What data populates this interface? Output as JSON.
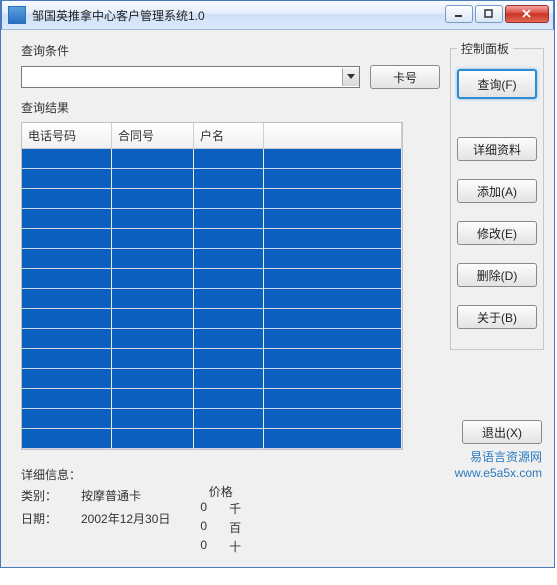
{
  "window": {
    "title": "邹国英推拿中心客户管理系统1.0"
  },
  "search": {
    "section_label": "查询条件",
    "combo_value": "",
    "card_btn": "卡号"
  },
  "results": {
    "section_label": "查询结果",
    "columns": [
      "电话号码",
      "合同号",
      "户名"
    ],
    "row_count": 15
  },
  "control_panel": {
    "title": "控制面板",
    "query_btn": "查询(F)",
    "detail_btn": "详细资料",
    "add_btn": "添加(A)",
    "edit_btn": "修改(E)",
    "delete_btn": "删除(D)",
    "about_btn": "关于(B)",
    "exit_btn": "退出(X)"
  },
  "details": {
    "heading": "详细信息：",
    "type_label": "类别：",
    "type_value": "按摩普通卡",
    "date_label": "日期：",
    "date_value": "2002年12月30日",
    "price_label": "价格",
    "qian_label": "千",
    "qian_value": "0",
    "bai_label": "百",
    "bai_value": "0",
    "shi_label": "十",
    "shi_value": "0"
  },
  "watermark": {
    "line1": "易语言资源网",
    "line2": "www.e5a5x.com"
  }
}
